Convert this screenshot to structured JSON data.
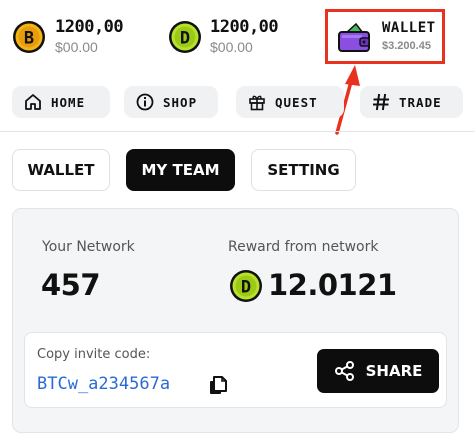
{
  "balances": [
    {
      "coin_letter": "B",
      "amount": "1200,00",
      "sub": "$00.00",
      "color": "#f2b417"
    },
    {
      "coin_letter": "D",
      "amount": "1200,00",
      "sub": "$00.00",
      "color": "#b7e12c"
    }
  ],
  "wallet": {
    "label": "WALLET",
    "value": "$3.200.45",
    "icon": "wallet-icon"
  },
  "nav": {
    "items": [
      {
        "label": "HOME",
        "icon": "home-icon"
      },
      {
        "label": "SHOP",
        "icon": "info-icon"
      },
      {
        "label": "QUEST",
        "icon": "gift-icon"
      },
      {
        "label": "TRADE",
        "icon": "hash-icon"
      }
    ]
  },
  "tabs": [
    {
      "label": "WALLET"
    },
    {
      "label": "MY TEAM",
      "active": true
    },
    {
      "label": "SETTING"
    }
  ],
  "network": {
    "your_network_label": "Your Network",
    "your_network_value": "457",
    "reward_label": "Reward from network",
    "reward_value": "12.0121",
    "reward_coin_letter": "D"
  },
  "invite": {
    "label": "Copy invite code:",
    "code": "BTCw_a234567a",
    "share_label": "SHARE"
  },
  "colors": {
    "highlight": "#e8321e",
    "wallet_purple": "#8a4fe0",
    "coin_gold": "#f2b417",
    "coin_green": "#b7e12c",
    "link_blue": "#2a6ad6",
    "active_tab": "#0d0d0d"
  }
}
